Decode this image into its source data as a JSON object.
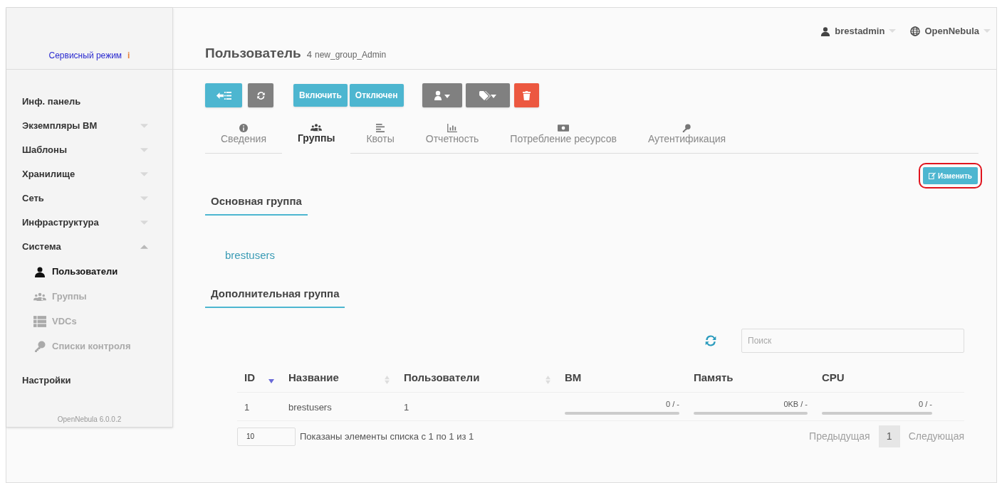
{
  "sidebar": {
    "service_mode": "Сервисный режим",
    "info_mark": "i",
    "items": [
      {
        "label": "Инф. панель",
        "kind": "link"
      },
      {
        "label": "Экземпляры ВМ",
        "kind": "menu",
        "expanded": false
      },
      {
        "label": "Шаблоны",
        "kind": "menu",
        "expanded": false
      },
      {
        "label": "Хранилище",
        "kind": "menu",
        "expanded": false
      },
      {
        "label": "Сеть",
        "kind": "menu",
        "expanded": false
      },
      {
        "label": "Инфраструктура",
        "kind": "menu",
        "expanded": false
      },
      {
        "label": "Система",
        "kind": "menu",
        "expanded": true,
        "children": [
          {
            "label": "Пользователи",
            "selected": true
          },
          {
            "label": "Группы",
            "selected": false
          },
          {
            "label": "VDCs",
            "selected": false
          },
          {
            "label": "Списки контроля",
            "selected": false
          }
        ]
      },
      {
        "label": "Настройки",
        "kind": "link"
      }
    ],
    "version": "OpenNebula 6.0.0.2"
  },
  "header": {
    "title": "Пользователь",
    "id": "4",
    "name": "new_group_Admin",
    "user": "brestadmin",
    "zone": "OpenNebula"
  },
  "toolbar": [
    {
      "kind": "back"
    },
    {
      "kind": "refresh"
    },
    {
      "kind": "text",
      "label": "Включить"
    },
    {
      "kind": "text",
      "label": "Отключен"
    },
    {
      "kind": "user-menu"
    },
    {
      "kind": "tag-menu"
    },
    {
      "kind": "delete"
    }
  ],
  "tabs": [
    {
      "label": "Сведения",
      "selected": false
    },
    {
      "label": "Группы",
      "selected": true
    },
    {
      "label": "Квоты",
      "selected": false
    },
    {
      "label": "Отчетность",
      "selected": false
    },
    {
      "label": "Потребление ресурсов",
      "selected": false
    },
    {
      "label": "Аутентификация",
      "selected": false
    }
  ],
  "edit_button": {
    "label": "Изменить",
    "highlighted": true
  },
  "primary_group": {
    "heading": "Основная группа",
    "value": "brestusers"
  },
  "secondary_group": {
    "heading": "Дополнительная группа",
    "search": {
      "placeholder": "Поиск"
    },
    "table": {
      "columns": [
        {
          "label": "ID",
          "kind": "sorted-desc"
        },
        {
          "label": "Название",
          "kind": "sortable"
        },
        {
          "label": "Пользователи",
          "kind": "sortable"
        },
        {
          "label": "ВМ",
          "kind": "plain"
        },
        {
          "label": "Память",
          "kind": "plain"
        },
        {
          "label": "CPU",
          "kind": "plain"
        }
      ],
      "rows": [
        {
          "id": "1",
          "name": "brestusers",
          "users": "1",
          "vms": {
            "reading": "0 / -",
            "level": 0
          },
          "memory": {
            "reading": "0KB / -",
            "level": 0
          },
          "cpu": {
            "reading": "0 / -",
            "level": 0
          }
        }
      ]
    },
    "page_size": "10",
    "info": "Показаны элементы списка с 1 по 1 из 1",
    "pagination": {
      "previous": "Предыдущая",
      "pages": [
        {
          "label": "1",
          "selected": true
        }
      ],
      "next": "Следующая"
    }
  }
}
